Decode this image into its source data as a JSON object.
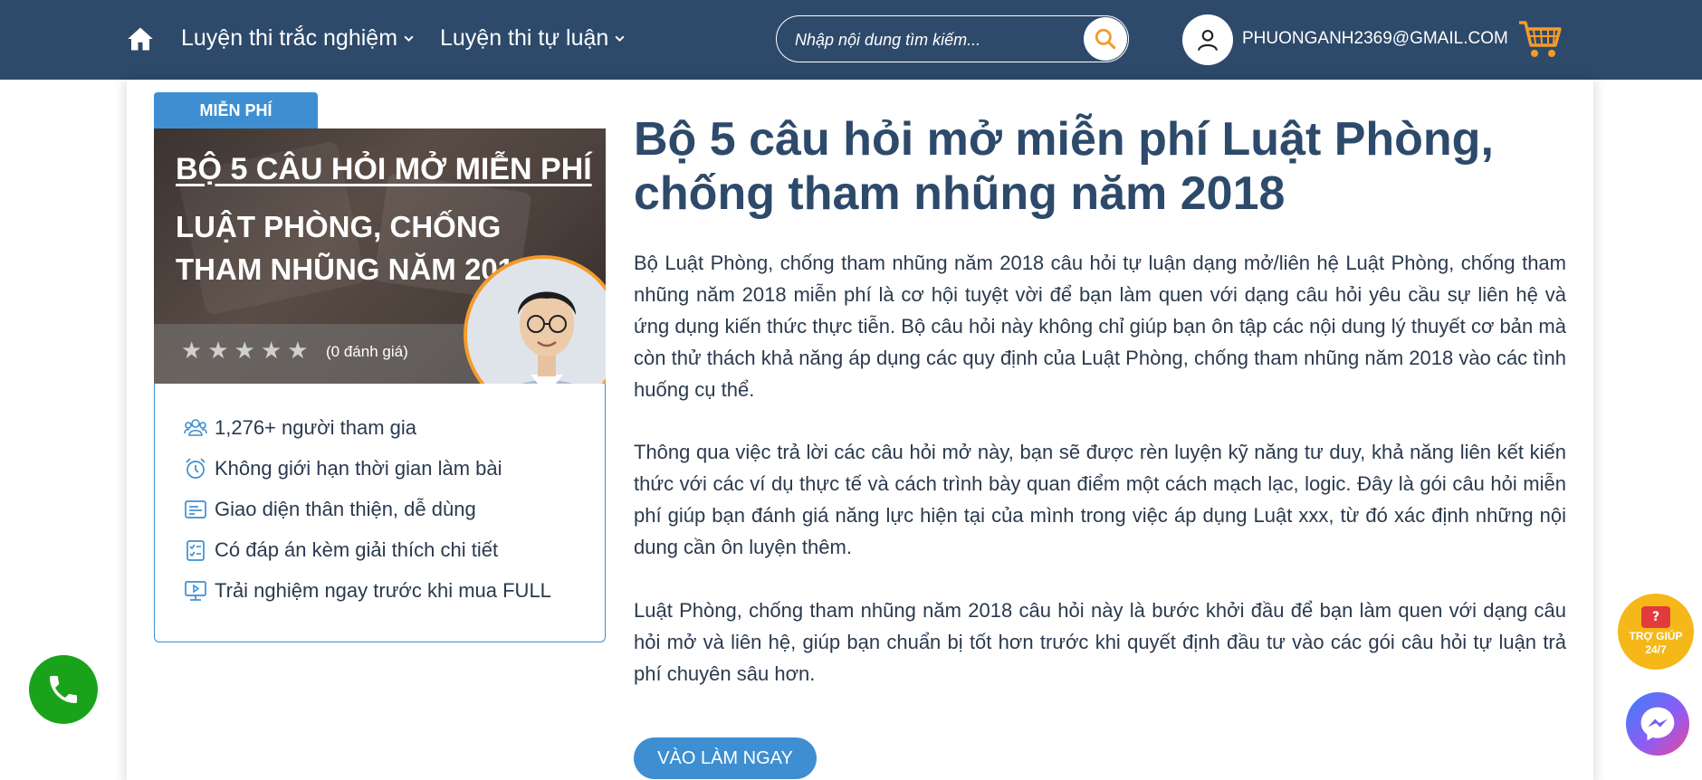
{
  "header": {
    "nav": [
      {
        "label": "Luyện thi trắc nghiệm"
      },
      {
        "label": "Luyện thi tự luận"
      }
    ],
    "search_placeholder": "Nhập nội dung tìm kiếm...",
    "user_email": "PHUONGANH2369@GMAIL.COM",
    "colors": {
      "bar": "#2d4a6b",
      "search_icon": "#f39c2b",
      "cart": "#f39c2b"
    }
  },
  "product": {
    "badge": "MIỄN PHÍ",
    "cover": {
      "title_line1": "BỘ 5 CÂU HỎI MỞ MIỄN PHÍ",
      "title_line2": "LUẬT PHÒNG, CHỐNG THAM NHŨNG NĂM 2018",
      "rating_stars": 0,
      "rating_max": 5,
      "rating_text": "(0 đánh giá)"
    },
    "features": [
      {
        "icon": "users-icon",
        "label": "1,276+ người tham gia"
      },
      {
        "icon": "alarm-clock-icon",
        "label": "Không giới hạn thời gian làm bài"
      },
      {
        "icon": "interface-icon",
        "label": "Giao diện thân thiện, dễ dùng"
      },
      {
        "icon": "checklist-icon",
        "label": "Có đáp án kèm giải thích chi tiết"
      },
      {
        "icon": "monitor-play-icon",
        "label": "Trải nghiệm ngay trước khi mua FULL"
      }
    ]
  },
  "content": {
    "headline": "Bộ 5 câu hỏi mở miễn phí Luật Phòng, chống tham nhũng năm 2018",
    "paragraphs": [
      "Bộ Luật Phòng, chống tham nhũng năm 2018 câu hỏi tự luận dạng mở/liên hệ Luật Phòng, chống tham nhũng năm 2018 miễn phí là cơ hội tuyệt vời để bạn làm quen với dạng câu hỏi yêu cầu sự liên hệ và ứng dụng kiến thức thực tiễn. Bộ câu hỏi này không chỉ giúp bạn ôn tập các nội dung lý thuyết cơ bản mà còn thử thách khả năng áp dụng các quy định của Luật Phòng, chống tham nhũng năm 2018  vào các tình huống cụ thể.",
      "Thông qua việc trả lời các câu hỏi mở này, bạn sẽ được rèn luyện kỹ năng tư duy, khả năng liên kết kiến thức với các ví dụ thực tế và cách trình bày quan điểm một cách mạch lạc, logic. Đây là gói câu hỏi miễn phí giúp bạn đánh giá năng lực hiện tại của mình trong việc áp dụng Luật xxx, từ đó xác định những nội dung cần ôn luyện thêm.",
      "Luật Phòng, chống tham nhũng năm 2018 câu hỏi này là bước khởi đầu để bạn làm quen với dạng câu hỏi mở và liên hệ, giúp bạn chuẩn bị tốt hơn trước khi quyết định đầu tư vào các gói câu hỏi tự luận trả phí chuyên sâu hơn."
    ],
    "cta_label": "VÀO LÀM NGAY"
  },
  "widgets": {
    "help_bubble": "?",
    "help_line1": "TRỢ GIÚP",
    "help_line2": "24/7"
  }
}
